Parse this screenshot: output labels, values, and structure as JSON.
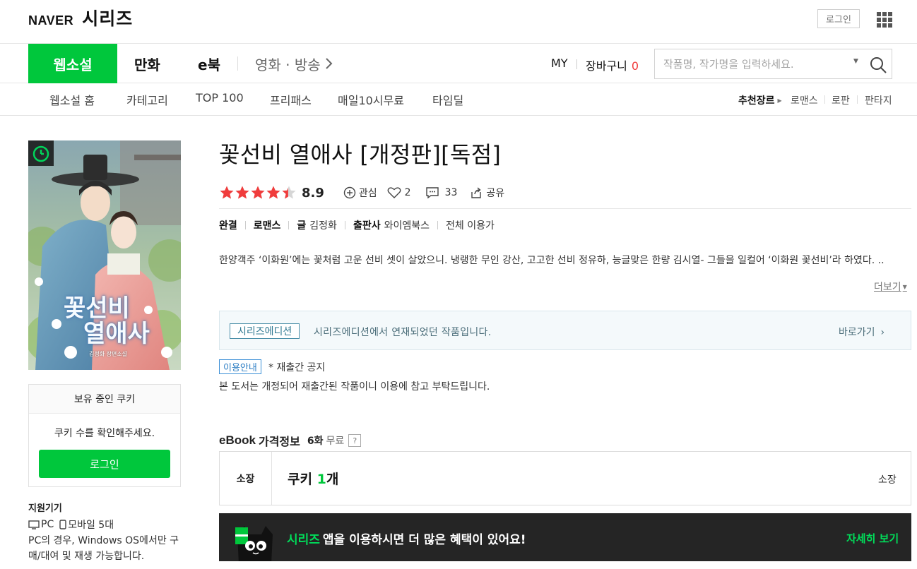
{
  "header": {
    "brand": "NAVER",
    "service": "시리즈",
    "login_label": "로그인"
  },
  "main_nav": {
    "tabs": [
      {
        "label": "웹소설",
        "active": true
      },
      {
        "label": "만화"
      },
      {
        "label": "e북"
      },
      {
        "label": "영화 · 방송"
      }
    ],
    "my_label": "MY",
    "cart_label": "장바구니",
    "cart_count": "0",
    "search_placeholder": "작품명, 작가명을 입력하세요."
  },
  "sub_nav": {
    "items": [
      "웹소설 홈",
      "카테고리",
      "TOP 100",
      "프리패스",
      "매일10시무료",
      "타임딜"
    ],
    "genre_label": "추천장르",
    "genres": [
      "로맨스",
      "로판",
      "판타지"
    ]
  },
  "book": {
    "cover_title_line1": "꽃선비",
    "cover_title_line2": "열애사",
    "cover_author": "김정화 장편소설",
    "title": "꽃선비 열애사 [개정판][독점]",
    "rating": 8.9,
    "rating_display": "8.9",
    "interest_label": "관심",
    "likes": "2",
    "comments": "33",
    "share_label": "공유",
    "status": "완결",
    "genre": "로맨스",
    "writer_label": "글",
    "writer": "김정화",
    "publisher_label": "출판사",
    "publisher": "와이엠북스",
    "age": "전체 이용가",
    "synopsis": "한양객주 ‘이화원’에는 꽃처럼 고운 선비 셋이 살았으니. 냉랭한 무인 강산, 고고한 선비 정유하, 능글맞은 한량 김시열- 그들을 일컬어 ‘이화원 꽃선비’라 하였다. ..",
    "more_label": "더보기"
  },
  "edition": {
    "tag": "시리즈에디션",
    "text": "시리즈에디션에서 연재되었던 작품입니다.",
    "go_label": "바로가기"
  },
  "notice": {
    "tag": "이용안내",
    "title": "* 재출간 공지",
    "body": "본 도서는 개정되어 재출간된 작품이니 이용에 참고 부탁드립니다."
  },
  "cookie": {
    "header": "보유 중인 쿠키",
    "message": "쿠키 수를 확인해주세요.",
    "login_label": "로그인"
  },
  "devices": {
    "title": "지원기기",
    "pc": "PC",
    "mobile": "모바일 5대",
    "note": "PC의 경우, Windows OS에서만 구매/대여 및 재생 가능합니다."
  },
  "price": {
    "ebook_label": "eBook",
    "info_label": "가격정보",
    "free_count": "6화",
    "free_label": "무료",
    "help": "?",
    "row_label": "소장",
    "cookie_prefix": "쿠키",
    "cookie_count": "1",
    "cookie_unit": "개",
    "row_right": "소장"
  },
  "banner": {
    "brand": "시리즈",
    "text": "앱을 이용하시면 더 많은 혜택이 있어요!",
    "more_label": "자세히 보기"
  },
  "colors": {
    "brand_green": "#00c73c",
    "star_red": "#f03c3c",
    "banner_bg": "#252525"
  }
}
